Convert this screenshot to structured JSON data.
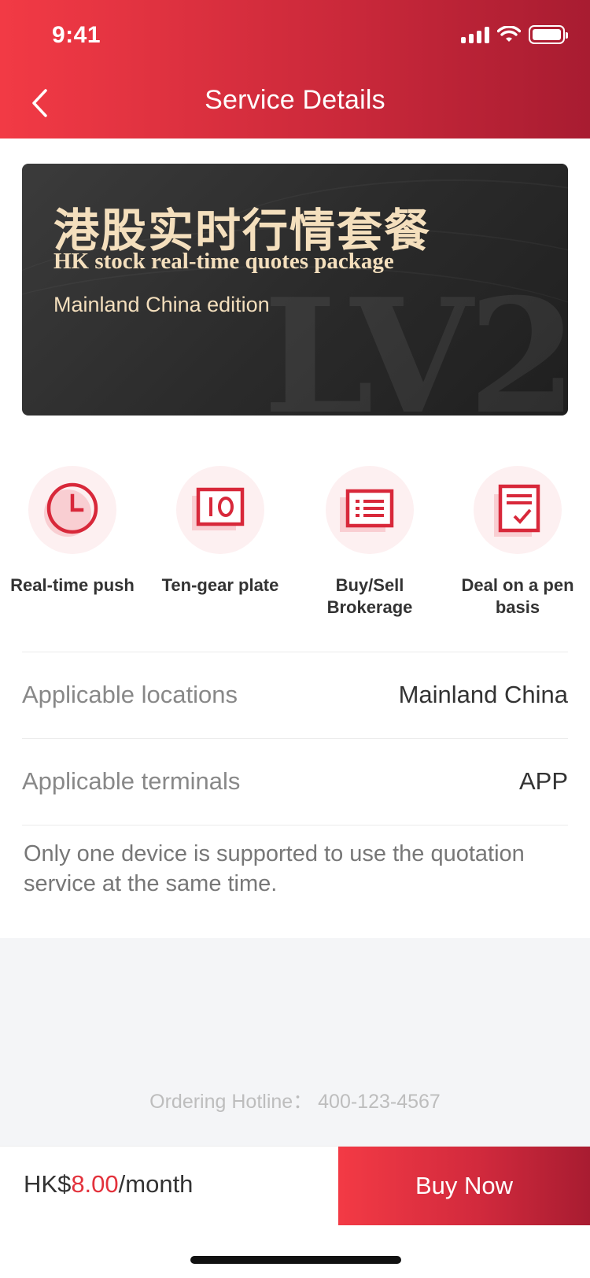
{
  "status_bar": {
    "time": "9:41"
  },
  "header": {
    "title": "Service Details"
  },
  "banner": {
    "title_cn": "港股实时行情套餐",
    "title_en": "HK stock real-time quotes package",
    "edition": "Mainland China edition",
    "watermark": "LV2"
  },
  "features": [
    {
      "label": "Real-time push",
      "icon": "clock-icon"
    },
    {
      "label": "Ten-gear plate",
      "icon": "ten-gear-icon"
    },
    {
      "label": "Buy/Sell Brokerage",
      "icon": "list-icon"
    },
    {
      "label": "Deal on a pen basis",
      "icon": "checklist-icon"
    }
  ],
  "details": {
    "locations_label": "Applicable locations",
    "locations_value": "Mainland China",
    "terminals_label": "Applicable terminals",
    "terminals_value": "APP",
    "notice": "Only one device is supported to use the quotation service at the same time."
  },
  "hotline": "Ordering Hotline：  400-123-4567",
  "footer": {
    "currency": "HK$",
    "amount": "8.00",
    "period": "/month",
    "buy_label": "Buy Now"
  },
  "colors": {
    "accent": "#e3323c",
    "header_start": "#f23a45",
    "header_end": "#a81c31",
    "banner_text": "#f4dfbd"
  }
}
